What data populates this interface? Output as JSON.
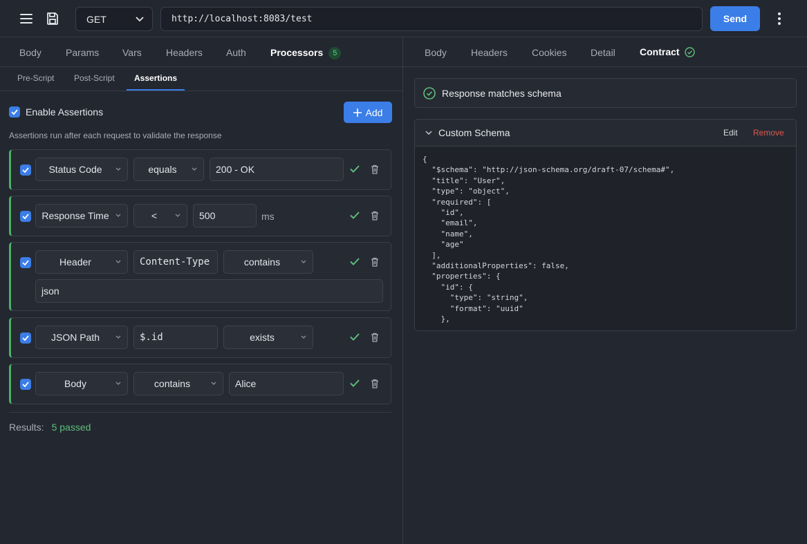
{
  "toolbar": {
    "menu_icon": "hamburger-icon",
    "save_icon": "save-icon",
    "method": "GET",
    "url": "http://localhost:8083/test",
    "send_label": "Send",
    "more_icon": "kebab-icon"
  },
  "request_tabs": [
    {
      "label": "Body"
    },
    {
      "label": "Params"
    },
    {
      "label": "Vars"
    },
    {
      "label": "Headers"
    },
    {
      "label": "Auth"
    },
    {
      "label": "Processors",
      "badge": "5",
      "active": true
    }
  ],
  "processor_tabs": [
    {
      "label": "Pre-Script"
    },
    {
      "label": "Post-Script"
    },
    {
      "label": "Assertions",
      "active": true
    }
  ],
  "assertions": {
    "enable_label": "Enable Assertions",
    "enabled": true,
    "add_label": "Add",
    "hint": "Assertions run after each request to validate the response",
    "rows": [
      {
        "type": "Status Code",
        "operator": "equals",
        "value": "200 - OK"
      },
      {
        "type": "Response Time",
        "operator": "<",
        "value": "500",
        "unit": "ms"
      },
      {
        "type": "Header",
        "key": "Content-Type",
        "operator": "contains",
        "value": "json"
      },
      {
        "type": "JSON Path",
        "key": "$.id",
        "operator": "exists"
      },
      {
        "type": "Body",
        "operator": "contains",
        "value": "Alice"
      }
    ],
    "results_label": "Results:",
    "results_value": "5 passed"
  },
  "response_tabs": [
    {
      "label": "Body"
    },
    {
      "label": "Headers"
    },
    {
      "label": "Cookies"
    },
    {
      "label": "Detail"
    },
    {
      "label": "Contract",
      "active": true
    }
  ],
  "contract": {
    "match_text": "Response matches schema",
    "schema_title": "Custom Schema",
    "edit_label": "Edit",
    "remove_label": "Remove",
    "schema_code": "{\n  \"$schema\": \"http://json-schema.org/draft-07/schema#\",\n  \"title\": \"User\",\n  \"type\": \"object\",\n  \"required\": [\n    \"id\",\n    \"email\",\n    \"name\",\n    \"age\"\n  ],\n  \"additionalProperties\": false,\n  \"properties\": {\n    \"id\": {\n      \"type\": \"string\",\n      \"format\": \"uuid\"\n    },"
  },
  "colors": {
    "accent": "#3b7ee8",
    "success": "#4caf6a",
    "danger": "#e0584f",
    "background": "#232730"
  }
}
